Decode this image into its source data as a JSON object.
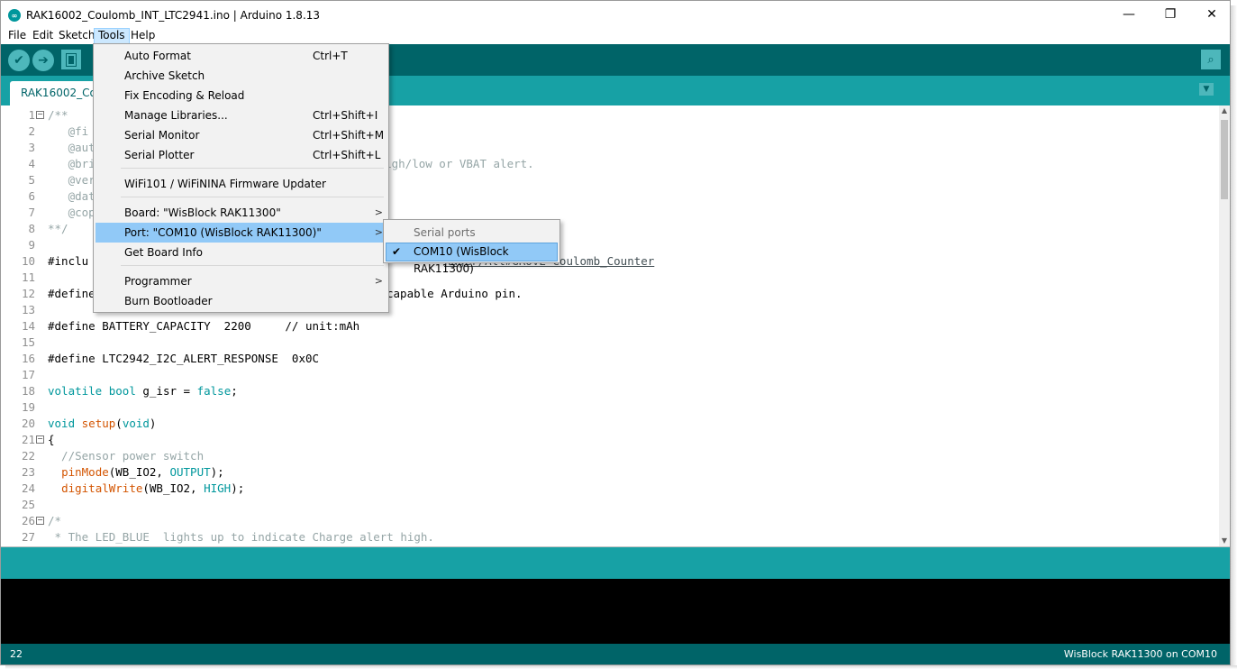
{
  "window": {
    "title": "RAK16002_Coulomb_INT_LTC2941.ino | Arduino 1.8.13",
    "controls": {
      "minimize": "—",
      "maximize": "❐",
      "close": "✕"
    }
  },
  "menubar": {
    "items": [
      "File",
      "Edit",
      "Sketch",
      "Tools",
      "Help"
    ],
    "active": "Tools"
  },
  "toolbar": {
    "buttons": [
      {
        "name": "verify",
        "icon": "check-icon",
        "glyph": "✔"
      },
      {
        "name": "upload",
        "icon": "arrow-right-icon",
        "glyph": "➔"
      },
      {
        "name": "new",
        "icon": "new-file-icon"
      }
    ],
    "serial_monitor_icon": "magnifier-icon",
    "serial_monitor_glyph": "⌕"
  },
  "tab": {
    "label": "RAK16002_Co",
    "menu_glyph": "▼"
  },
  "tools_menu": {
    "items": [
      {
        "label": "Auto Format",
        "shortcut": "Ctrl+T"
      },
      {
        "label": "Archive Sketch",
        "shortcut": ""
      },
      {
        "label": "Fix Encoding & Reload",
        "shortcut": ""
      },
      {
        "label": "Manage Libraries...",
        "shortcut": "Ctrl+Shift+I"
      },
      {
        "label": "Serial Monitor",
        "shortcut": "Ctrl+Shift+M"
      },
      {
        "label": "Serial Plotter",
        "shortcut": "Ctrl+Shift+L"
      },
      {
        "label": "WiFi101 / WiFiNINA Firmware Updater",
        "shortcut": ""
      },
      {
        "label": "Board: \"WisBlock RAK11300\"",
        "shortcut": "",
        "submenu_glyph": ">"
      },
      {
        "label": "Port: \"COM10 (WisBlock RAK11300)\"",
        "shortcut": "",
        "submenu_glyph": ">",
        "highlighted": true
      },
      {
        "label": "Get Board Info",
        "shortcut": ""
      },
      {
        "label": "Programmer",
        "shortcut": "",
        "submenu_glyph": ">"
      },
      {
        "label": "Burn Bootloader",
        "shortcut": ""
      }
    ]
  },
  "port_submenu": {
    "header": "Serial ports",
    "item": "COM10 (WisBlock RAK11300)",
    "check_glyph": "✔"
  },
  "editor": {
    "fold_glyph": "−",
    "lines": [
      {
        "n": "1",
        "text": "/**"
      },
      {
        "n": "2",
        "text": "   @fi"
      },
      {
        "n": "3",
        "text": "   @aut"
      },
      {
        "n": "4",
        "text": "   @bri",
        "tail": "rt high/low or VBAT alert."
      },
      {
        "n": "5",
        "text": "   @ver"
      },
      {
        "n": "6",
        "text": "   @dat"
      },
      {
        "n": "7",
        "text": "   @cop"
      },
      {
        "n": "8",
        "text": "**/"
      },
      {
        "n": "9",
        "text": ""
      },
      {
        "n": "10",
        "text": "#inclu",
        "tail": "nager/All#GROVE-Coulomb_Counter"
      },
      {
        "n": "11",
        "text": ""
      },
      {
        "n": "12",
        "text": "#define",
        "tail": "capable Arduino pin."
      },
      {
        "n": "13",
        "text": ""
      },
      {
        "n": "14",
        "text": "#define BATTERY_CAPACITY  2200     // unit:mAh"
      },
      {
        "n": "15",
        "text": ""
      },
      {
        "n": "16",
        "text": "#define LTC2942_I2C_ALERT_RESPONSE  0x0C"
      },
      {
        "n": "17",
        "text": ""
      },
      {
        "n": "18",
        "kw": "volatile",
        "type": "bool",
        "rest": " g_isr = ",
        "lit": "false",
        "end": ";"
      },
      {
        "n": "19",
        "text": ""
      },
      {
        "n": "20",
        "kw": "void",
        "fn": "setup",
        "open": "(",
        "type2": "void",
        "close": ")"
      },
      {
        "n": "21",
        "text": "{"
      },
      {
        "n": "22",
        "text": "  //Sensor power switch"
      },
      {
        "n": "23",
        "indent": "  ",
        "fn": "pinMode",
        "args_a": "(WB_IO2, ",
        "const": "OUTPUT",
        "args_b": ");"
      },
      {
        "n": "24",
        "indent": "  ",
        "fn": "digitalWrite",
        "args_a": "(WB_IO2, ",
        "const": "HIGH",
        "args_b": ");"
      },
      {
        "n": "25",
        "text": ""
      },
      {
        "n": "26",
        "text": "/*"
      },
      {
        "n": "27",
        "text": " * The LED_BLUE  lights up to indicate Charge alert high."
      }
    ]
  },
  "status": {
    "line": "22",
    "board_port": "WisBlock RAK11300 on COM10"
  }
}
